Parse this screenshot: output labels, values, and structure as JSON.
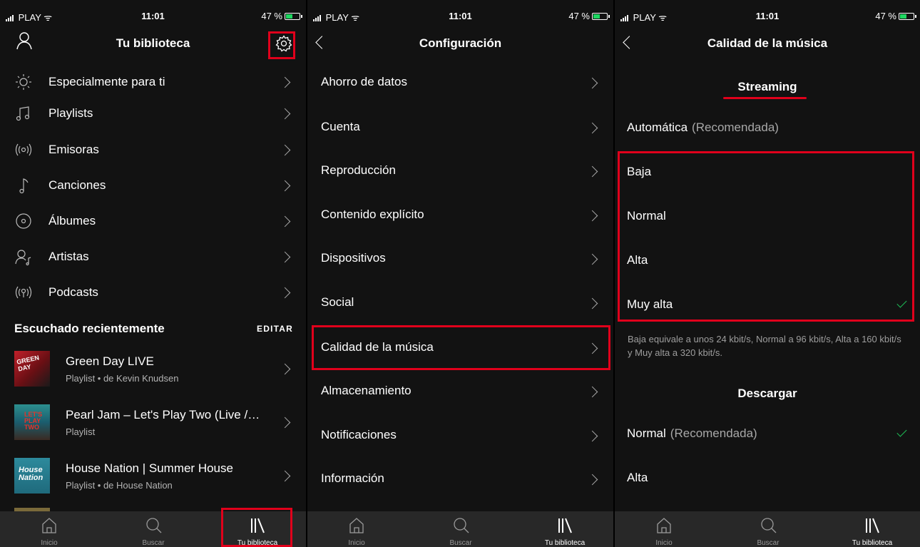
{
  "status": {
    "carrier": "PLAY",
    "time": "11:01",
    "battery": "47 %"
  },
  "panel1": {
    "title": "Tu biblioteca",
    "menu": [
      {
        "label": "Especialmente para ti",
        "icon": "sun-icon"
      },
      {
        "label": "Playlists",
        "icon": "music-note-icon"
      },
      {
        "label": "Emisoras",
        "icon": "radio-icon"
      },
      {
        "label": "Canciones",
        "icon": "note-icon"
      },
      {
        "label": "Álbumes",
        "icon": "album-icon"
      },
      {
        "label": "Artistas",
        "icon": "artist-icon"
      },
      {
        "label": "Podcasts",
        "icon": "podcast-icon"
      }
    ],
    "recent_title": "Escuchado recientemente",
    "edit_label": "EDITAR",
    "recent": [
      {
        "name": "Green Day LIVE",
        "sub": "Playlist • de Kevin Knudsen"
      },
      {
        "name": "Pearl Jam – Let's Play Two (Live /…",
        "sub": "Playlist"
      },
      {
        "name": "House Nation | Summer House",
        "sub": "Playlist • de House Nation"
      }
    ]
  },
  "panel2": {
    "title": "Configuración",
    "items": [
      {
        "label": "Ahorro de datos"
      },
      {
        "label": "Cuenta"
      },
      {
        "label": "Reproducción"
      },
      {
        "label": "Contenido explícito"
      },
      {
        "label": "Dispositivos"
      },
      {
        "label": "Social"
      },
      {
        "label": "Calidad de la música"
      },
      {
        "label": "Almacenamiento"
      },
      {
        "label": "Notificaciones"
      },
      {
        "label": "Información"
      }
    ]
  },
  "panel3": {
    "title": "Calidad de la música",
    "streaming_title": "Streaming",
    "auto_label": "Automática",
    "recommended": "(Recomendada)",
    "streaming_options": [
      {
        "label": "Baja",
        "selected": false
      },
      {
        "label": "Normal",
        "selected": false
      },
      {
        "label": "Alta",
        "selected": false
      },
      {
        "label": "Muy alta",
        "selected": true
      }
    ],
    "note": "Baja equivale a unos 24 kbit/s, Normal a 96 kbit/s, Alta a 160 kbit/s y Muy alta a 320 kbit/s.",
    "download_title": "Descargar",
    "download_options": [
      {
        "label": "Normal",
        "recommended": "(Recomendada)",
        "selected": true
      },
      {
        "label": "Alta",
        "selected": false
      }
    ]
  },
  "tabs": [
    {
      "label": "Inicio",
      "icon": "home-icon"
    },
    {
      "label": "Buscar",
      "icon": "search-icon"
    },
    {
      "label": "Tu biblioteca",
      "icon": "library-icon"
    }
  ],
  "colors": {
    "accent": "#1db954",
    "highlight": "#e0001b",
    "background": "#121212"
  }
}
